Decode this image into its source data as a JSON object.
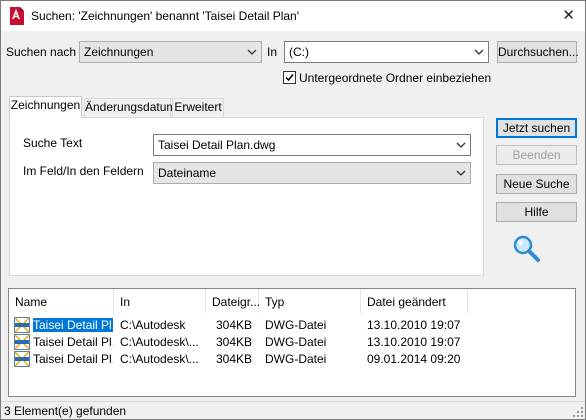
{
  "window": {
    "title": "Suchen: 'Zeichnungen' benannt 'Taisei Detail Plan'",
    "close_glyph": "✕"
  },
  "search": {
    "search_for_label": "Suchen nach",
    "search_for_value": "Zeichnungen",
    "in_label": "In",
    "in_value": "(C:)",
    "browse_label": "Durchsuchen...",
    "subfolders_label": "Untergeordnete Ordner einbeziehen",
    "subfolders_checked": true
  },
  "tabs": [
    {
      "label": "Zeichnungen",
      "active": true
    },
    {
      "label": "Änderungsdatum",
      "active": false
    },
    {
      "label": "Erweitert",
      "active": false
    }
  ],
  "drawing_tab": {
    "search_text_label": "Suche Text",
    "search_text_value": "Taisei Detail Plan.dwg",
    "field_label": "Im Feld/In den Feldern",
    "field_value": "Dateiname"
  },
  "buttons": {
    "search_now": "Jetzt suchen",
    "stop": "Beenden",
    "new_search": "Neue Suche",
    "help": "Hilfe"
  },
  "results": {
    "columns": [
      "Name",
      "In",
      "Dateigr...",
      "Typ",
      "Datei geändert"
    ],
    "rows": [
      {
        "name": "Taisei Detail Pl...",
        "in": "C:\\Autodesk",
        "size": "304KB",
        "type": "DWG-Datei",
        "modified": "13.10.2010 19:07",
        "selected": true
      },
      {
        "name": "Taisei Detail Pl...",
        "in": "C:\\Autodesk\\...",
        "size": "304KB",
        "type": "DWG-Datei",
        "modified": "13.10.2010 19:07",
        "selected": false
      },
      {
        "name": "Taisei Detail Pl...",
        "in": "C:\\Autodesk\\...",
        "size": "304KB",
        "type": "DWG-Datei",
        "modified": "09.01.2014 09:20",
        "selected": false
      }
    ]
  },
  "status": {
    "text": "3 Element(e) gefunden"
  },
  "icons": {
    "app": "autocad-app-icon",
    "search": "magnifier-icon",
    "file": "dwg-file-icon"
  },
  "colors": {
    "accent": "#0078d7",
    "app_icon_red": "#c8102e",
    "magnifier_blue": "#2b8fd6"
  }
}
